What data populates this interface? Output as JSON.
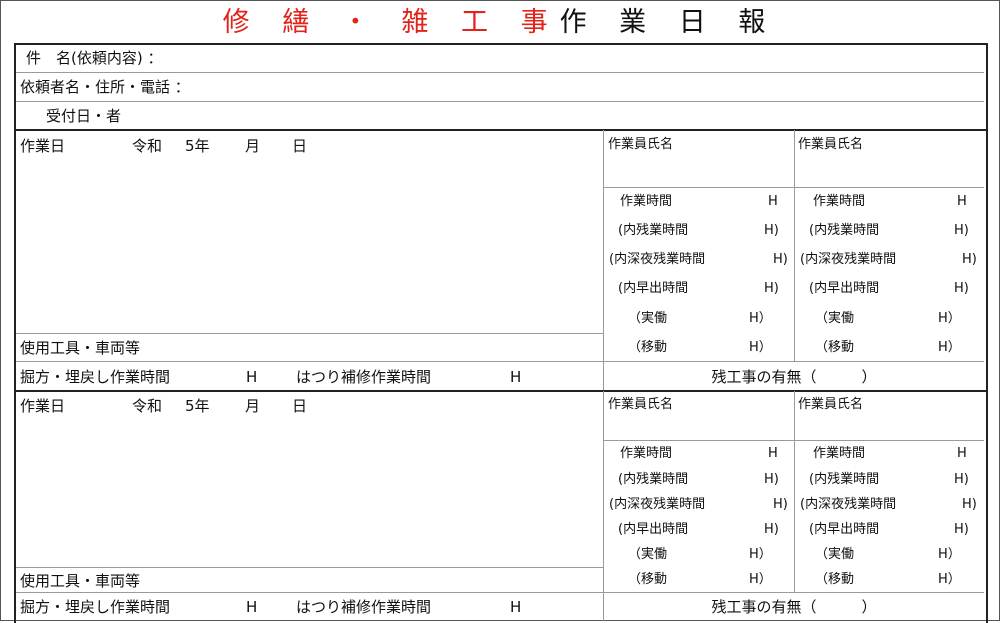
{
  "title": {
    "red": "修 繕 ・ 雑 工 事",
    "black": "作 業 日 報"
  },
  "header": {
    "subject": "件　名(依頼内容) ：",
    "requester": "依頼者名・住所・電話 ：",
    "received": "受付日・者"
  },
  "sections": [
    {
      "work_date_label": "作業日",
      "era": "令和",
      "year": "5年",
      "month": "月",
      "day": "日",
      "tools_label": "使用工具・車両等",
      "dig_label": "掘方・埋戻し作業時間",
      "dig_unit": "H",
      "chip_label": "はつり補修作業時間",
      "chip_unit": "H",
      "remaining_label": "残工事の有無（　　　）",
      "workers": [
        {
          "name_label": "作業員氏名",
          "hours": "作業時間",
          "hours_unit": "H",
          "overtime": "(内残業時間",
          "overtime_unit": "H)",
          "night": "(内深夜残業時間",
          "night_unit": "H)",
          "early": "(内早出時間",
          "early_unit": "H)",
          "actual": "（実働",
          "actual_unit": "H）",
          "travel": "（移動",
          "travel_unit": "H）"
        },
        {
          "name_label": "作業員氏名",
          "hours": "作業時間",
          "hours_unit": "H",
          "overtime": "(内残業時間",
          "overtime_unit": "H)",
          "night": "(内深夜残業時間",
          "night_unit": "H)",
          "early": "(内早出時間",
          "early_unit": "H)",
          "actual": "（実働",
          "actual_unit": "H）",
          "travel": "（移動",
          "travel_unit": "H）"
        }
      ]
    },
    {
      "work_date_label": "作業日",
      "era": "令和",
      "year": "5年",
      "month": "月",
      "day": "日",
      "tools_label": "使用工具・車両等",
      "dig_label": "掘方・埋戻し作業時間",
      "dig_unit": "H",
      "chip_label": "はつり補修作業時間",
      "chip_unit": "H",
      "remaining_label": "残工事の有無（　　　）",
      "workers": [
        {
          "name_label": "作業員氏名",
          "hours": "作業時間",
          "hours_unit": "H",
          "overtime": "(内残業時間",
          "overtime_unit": "H)",
          "night": "(内深夜残業時間",
          "night_unit": "H)",
          "early": "(内早出時間",
          "early_unit": "H)",
          "actual": "（実働",
          "actual_unit": "H）",
          "travel": "（移動",
          "travel_unit": "H）"
        },
        {
          "name_label": "作業員氏名",
          "hours": "作業時間",
          "hours_unit": "H",
          "overtime": "(内残業時間",
          "overtime_unit": "H)",
          "night": "(内深夜残業時間",
          "night_unit": "H)",
          "early": "(内早出時間",
          "early_unit": "H)",
          "actual": "（実働",
          "actual_unit": "H）",
          "travel": "（移動",
          "travel_unit": "H）"
        }
      ]
    }
  ]
}
